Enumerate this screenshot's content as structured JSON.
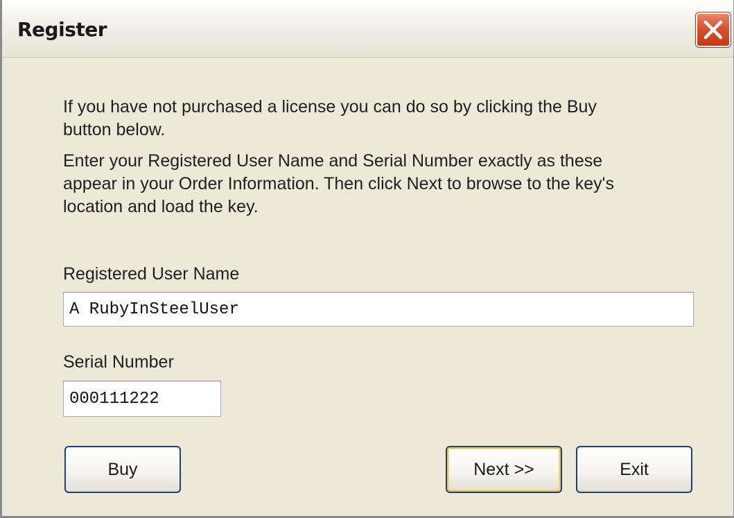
{
  "window": {
    "title": "Register"
  },
  "body": {
    "paragraph1": "If you have not purchased a license you can do so by clicking the Buy button below.",
    "paragraph2": "Enter your Registered User Name and Serial Number exactly as these appear in your Order Information. Then click Next to browse to the key's location and load the key."
  },
  "fields": {
    "user_name_label": "Registered User Name",
    "user_name_value": "A RubyInSteelUser",
    "serial_label": "Serial Number",
    "serial_value": "000111222"
  },
  "buttons": {
    "buy": "Buy",
    "next": "Next >>",
    "exit": "Exit"
  },
  "icons": {
    "close": "close-icon"
  },
  "colors": {
    "dialog_background": "#ece9d8",
    "close_button": "#d6532f",
    "button_border": "#1c3f7a",
    "default_button_highlight": "#f2c354"
  }
}
